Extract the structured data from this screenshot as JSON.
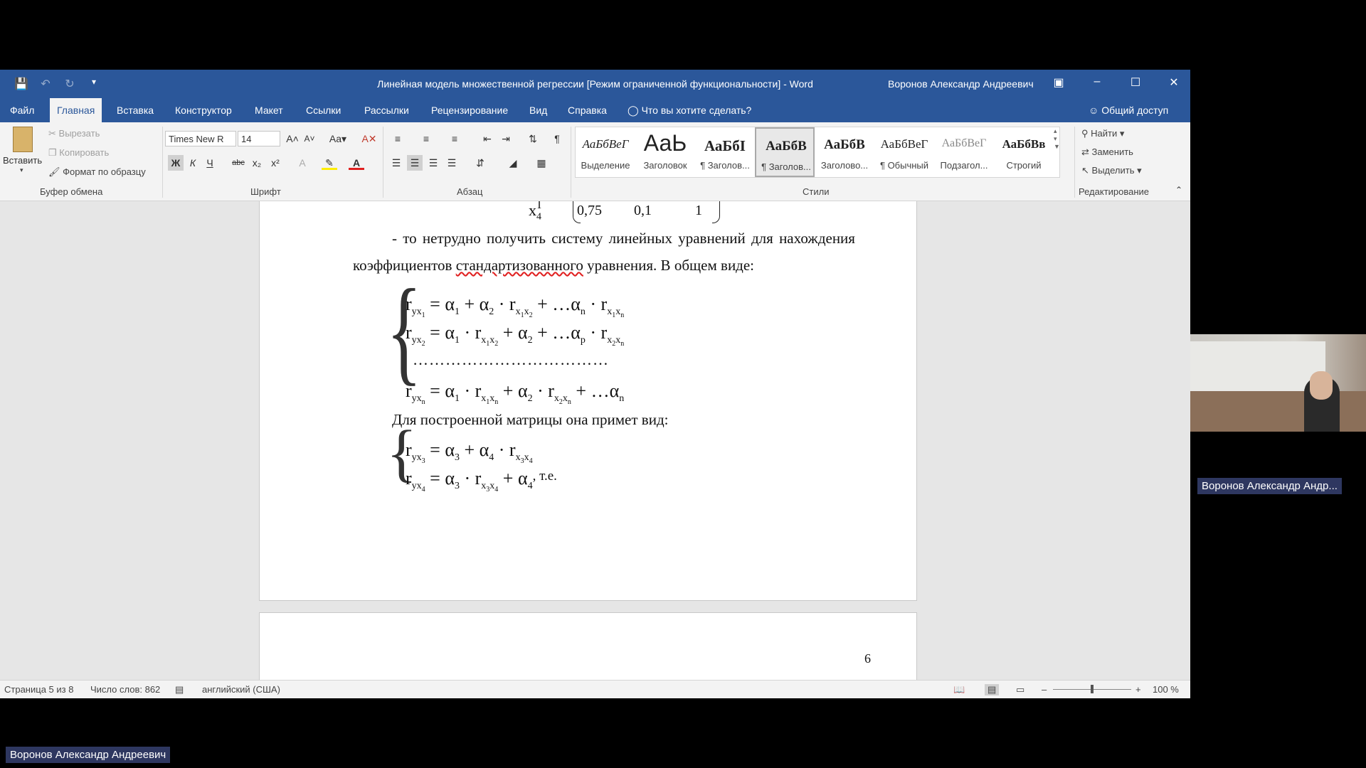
{
  "window": {
    "title": "Линейная модель множественной регрессии [Режим ограниченной функциональности]  -  Word",
    "user": "Воронов Александр Андреевич"
  },
  "tabs": [
    "Файл",
    "Главная",
    "Вставка",
    "Конструктор",
    "Макет",
    "Ссылки",
    "Рассылки",
    "Рецензирование",
    "Вид",
    "Справка"
  ],
  "tell_me": "Что вы хотите сделать?",
  "share": "Общий доступ",
  "clipboard": {
    "paste": "Вставить",
    "cut": "Вырезать",
    "copy": "Копировать",
    "format_painter": "Формат по образцу",
    "label": "Буфер обмена"
  },
  "font": {
    "name": "Times New R",
    "size": "14",
    "label": "Шрифт"
  },
  "paragraph": {
    "label": "Абзац"
  },
  "styles": {
    "label": "Стили",
    "items": [
      {
        "sample": "АаБбВеГ",
        "name": "Выделение"
      },
      {
        "sample": "АаЬ",
        "name": "Заголовок"
      },
      {
        "sample": "АаБбI",
        "name": "¶ Заголов..."
      },
      {
        "sample": "АаБбВ",
        "name": "¶ Заголов..."
      },
      {
        "sample": "АаБбВ",
        "name": "Заголово..."
      },
      {
        "sample": "АаБбВеГ",
        "name": "¶ Обычный"
      },
      {
        "sample": "АаБбВеГ",
        "name": "Подзагол..."
      },
      {
        "sample": "АаБбВв",
        "name": "Строгий"
      }
    ]
  },
  "editing": {
    "find": "Найти",
    "replace": "Заменить",
    "select": "Выделить",
    "label": "Редактирование"
  },
  "document": {
    "matrix_row": {
      "var": "x",
      "var_sub": "4",
      "v1": "0,75",
      "v2": "0,1",
      "v3": "1"
    },
    "para1_line1": "- то нетрудно получить систему линейных уравнений для нахождения",
    "para1_line2_a": "коэффициентов ",
    "para1_line2_err": "стандартизованного",
    "para1_line2_b": " уравнения. В общем виде:",
    "dots": "………………………………",
    "para2": "Для построенной матрицы она примет вид:",
    "te": ", т.е.",
    "page_number": "6"
  },
  "status": {
    "page": "Страница 5 из 8",
    "words": "Число слов: 862",
    "lang": "английский (США)",
    "zoom": "100 %"
  },
  "participants": {
    "side_name": "Воронов Александр Андр...",
    "bottom_name": "Воронов Александр Андреевич"
  }
}
